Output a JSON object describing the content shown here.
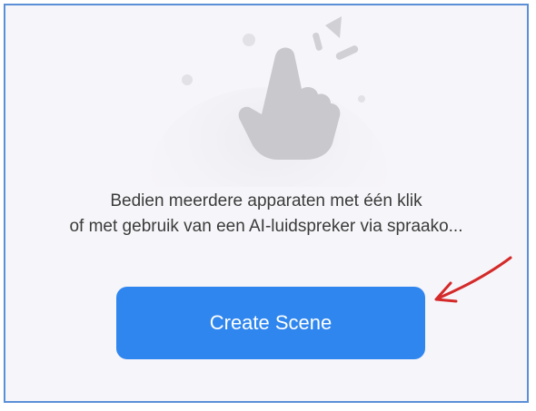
{
  "empty_state": {
    "description_line1": "Bedien meerdere apparaten met één klik",
    "description_line2": "of met gebruik van een AI-luidspreker via spraako...",
    "icon": "tap-hand-icon"
  },
  "actions": {
    "create_scene_label": "Create Scene"
  },
  "colors": {
    "button": "#2f86ee",
    "background": "#f6f5f9",
    "annotation_arrow": "#d42a2a",
    "frame_border": "#5b8fd6"
  }
}
